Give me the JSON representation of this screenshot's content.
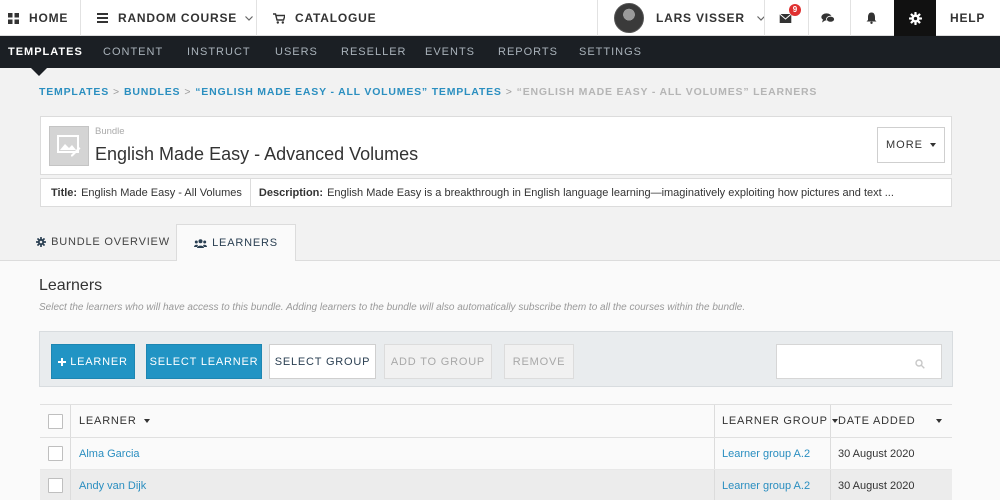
{
  "topbar": {
    "home_label": "HOME",
    "course_label": "RANDOM COURSE",
    "catalogue_label": "CATALOGUE",
    "user_name": "LARS VISSER",
    "message_count": "9",
    "help_label": "HELP"
  },
  "nav": {
    "items": [
      {
        "label": "TEMPLATES"
      },
      {
        "label": "CONTENT"
      },
      {
        "label": "INSTRUCT"
      },
      {
        "label": "USERS"
      },
      {
        "label": "RESELLER"
      },
      {
        "label": "EVENTS"
      },
      {
        "label": "REPORTS"
      },
      {
        "label": "SETTINGS"
      }
    ]
  },
  "breadcrumb": {
    "items": [
      {
        "label": "TEMPLATES"
      },
      {
        "label": "BUNDLES"
      },
      {
        "label": "“ENGLISH MADE EASY - ALL VOLUMES” TEMPLATES"
      }
    ],
    "current": "“ENGLISH MADE EASY - ALL VOLUMES” LEARNERS",
    "separator": ">"
  },
  "bundle": {
    "type_label": "Bundle",
    "title": "English Made Easy - Advanced Volumes",
    "more_label": "MORE",
    "meta_title_key": "Title:",
    "meta_title_value": "English Made Easy - All Volumes",
    "meta_desc_key": "Description:",
    "meta_desc_value": "English Made Easy is a breakthrough in English language learning—imaginatively exploiting how pictures and text ..."
  },
  "tabs": {
    "overview_label": "BUNDLE OVERVIEW",
    "learners_label": "LEARNERS"
  },
  "panel": {
    "title": "Learners",
    "description": "Select the learners who will have access to this bundle. Adding learners to the bundle will also automatically subscribe them to all the courses within the bundle."
  },
  "toolbar": {
    "add_learner_label": "LEARNER",
    "select_learner_label": "SELECT LEARNER",
    "select_group_label": "SELECT GROUP",
    "add_to_group_label": "ADD TO GROUP",
    "remove_label": "REMOVE",
    "search_value": ""
  },
  "table": {
    "columns": {
      "learner": "LEARNER",
      "group": "LEARNER GROUP",
      "date": "DATE ADDED"
    },
    "rows": [
      {
        "name": "Alma Garcia",
        "group": "Learner group A.2",
        "date": "30 August 2020"
      },
      {
        "name": "Andy van Dijk",
        "group": "Learner group A.2",
        "date": "30 August 2020"
      }
    ]
  },
  "colors": {
    "accent": "#2194c4",
    "nav_bg": "#1b1f24",
    "link": "#2a8ec0",
    "badge": "#e03030"
  },
  "icons": [
    "grid-icon",
    "hamburger-icon",
    "chevron-down-icon",
    "cart-icon",
    "avatar",
    "inbox-icon",
    "chat-icon",
    "bell-icon",
    "gear-icon",
    "image-edit-icon",
    "cog-icon",
    "users-icon",
    "plus-icon",
    "search-icon",
    "caret-down-icon"
  ]
}
